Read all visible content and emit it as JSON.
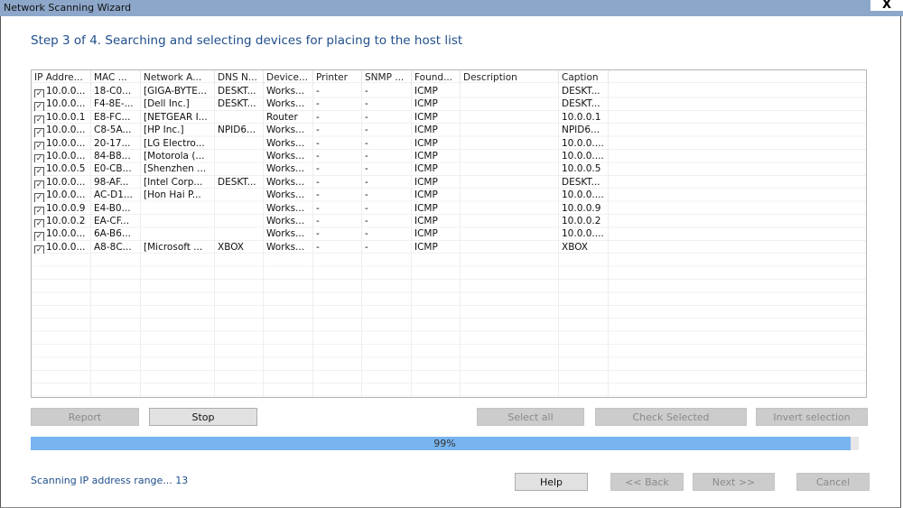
{
  "window": {
    "title": "Network Scanning Wizard",
    "close_label": "X"
  },
  "step_title": "Step 3 of 4. Searching and selecting devices for placing to the host list",
  "columns": [
    "IP Addre...",
    "MAC ...",
    "Network A...",
    "DNS N...",
    "Device...",
    "Printer",
    "SNMP ...",
    "Found...",
    "Description",
    "Caption"
  ],
  "rows": [
    {
      "checked": true,
      "cells": [
        "10.0.0...",
        "18-C0...",
        "[GIGA-BYTE...",
        "DESKT...",
        "Works...",
        "-",
        "-",
        "ICMP",
        "",
        "DESKT..."
      ]
    },
    {
      "checked": true,
      "cells": [
        "10.0.0...",
        "F4-8E-...",
        "[Dell Inc.]",
        "DESKT...",
        "Works...",
        "-",
        "-",
        "ICMP",
        "",
        "DESKT..."
      ]
    },
    {
      "checked": true,
      "cells": [
        "10.0.0.1",
        "E8-FC...",
        "[NETGEAR I...",
        "",
        "Router",
        "-",
        "-",
        "ICMP",
        "",
        "10.0.0.1"
      ]
    },
    {
      "checked": true,
      "cells": [
        "10.0.0...",
        "C8-5A...",
        "[HP Inc.]",
        "NPID6...",
        "Works...",
        "-",
        "-",
        "ICMP",
        "",
        "NPID6..."
      ]
    },
    {
      "checked": true,
      "cells": [
        "10.0.0...",
        "20-17...",
        "[LG Electro...",
        "",
        "Works...",
        "-",
        "-",
        "ICMP",
        "",
        "10.0.0...."
      ]
    },
    {
      "checked": true,
      "cells": [
        "10.0.0...",
        "84-B8...",
        "[Motorola (...",
        "",
        "Works...",
        "-",
        "-",
        "ICMP",
        "",
        "10.0.0...."
      ]
    },
    {
      "checked": true,
      "cells": [
        "10.0.0.5",
        "E0-CB...",
        "[Shenzhen ...",
        "",
        "Works...",
        "-",
        "-",
        "ICMP",
        "",
        "10.0.0.5"
      ]
    },
    {
      "checked": true,
      "cells": [
        "10.0.0...",
        "98-AF...",
        "[Intel Corp...",
        "DESKT...",
        "Works...",
        "-",
        "-",
        "ICMP",
        "",
        "DESKT..."
      ]
    },
    {
      "checked": true,
      "cells": [
        "10.0.0...",
        "AC-D1...",
        "[Hon Hai P...",
        "",
        "Works...",
        "-",
        "-",
        "ICMP",
        "",
        "10.0.0...."
      ]
    },
    {
      "checked": true,
      "cells": [
        "10.0.0.9",
        "E4-B0...",
        "",
        "",
        "Works...",
        "-",
        "-",
        "ICMP",
        "",
        "10.0.0.9"
      ]
    },
    {
      "checked": true,
      "cells": [
        "10.0.0.2",
        "EA-CF...",
        "",
        "",
        "Works...",
        "-",
        "-",
        "ICMP",
        "",
        "10.0.0.2"
      ]
    },
    {
      "checked": true,
      "cells": [
        "10.0.0...",
        "6A-B6...",
        "",
        "",
        "Works...",
        "-",
        "-",
        "ICMP",
        "",
        "10.0.0...."
      ]
    },
    {
      "checked": true,
      "cells": [
        "10.0.0...",
        "A8-8C...",
        "[Microsoft ...",
        "XBOX",
        "Works...",
        "-",
        "-",
        "ICMP",
        "",
        "XBOX"
      ]
    }
  ],
  "buttons": {
    "report": "Report",
    "stop": "Stop",
    "select_all": "Select all",
    "check_selected": "Check Selected",
    "invert_selection": "Invert selection",
    "help": "Help",
    "back": "<< Back",
    "next": "Next >>",
    "cancel": "Cancel"
  },
  "progress": {
    "value": 99,
    "label": "99%"
  },
  "status": "Scanning IP address range... 13",
  "colors": {
    "title_bar": "#8da7ca",
    "accent_text": "#1f4e8c",
    "progress_fill": "#78b4f0"
  }
}
